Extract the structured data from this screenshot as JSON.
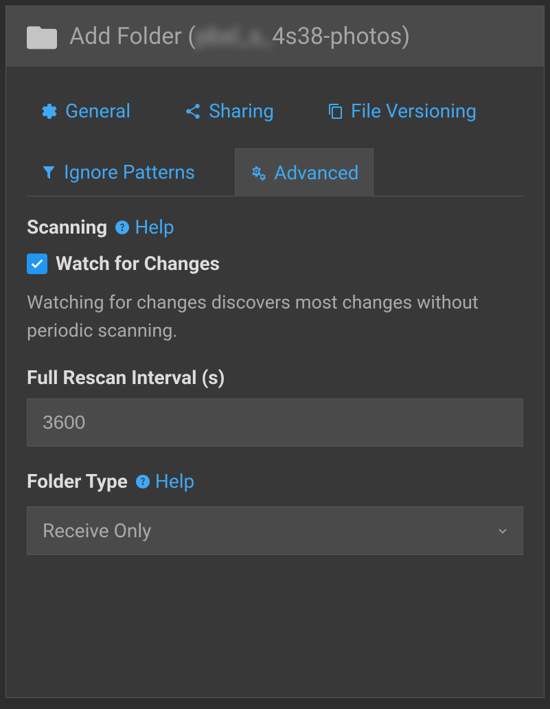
{
  "header": {
    "title_prefix": "Add Folder (",
    "title_obscured": "pbxl_s_",
    "title_suffix": "4s38-photos)"
  },
  "tabs": {
    "general": "General",
    "sharing": "Sharing",
    "file_versioning": "File Versioning",
    "ignore_patterns": "Ignore Patterns",
    "advanced": "Advanced"
  },
  "scanning": {
    "title": "Scanning",
    "help": "Help",
    "watch_label": "Watch for Changes",
    "watch_description": "Watching for changes discovers most changes without periodic scanning.",
    "rescan_label": "Full Rescan Interval (s)",
    "rescan_value": "3600"
  },
  "folder_type": {
    "label": "Folder Type",
    "help": "Help",
    "value": "Receive Only"
  }
}
